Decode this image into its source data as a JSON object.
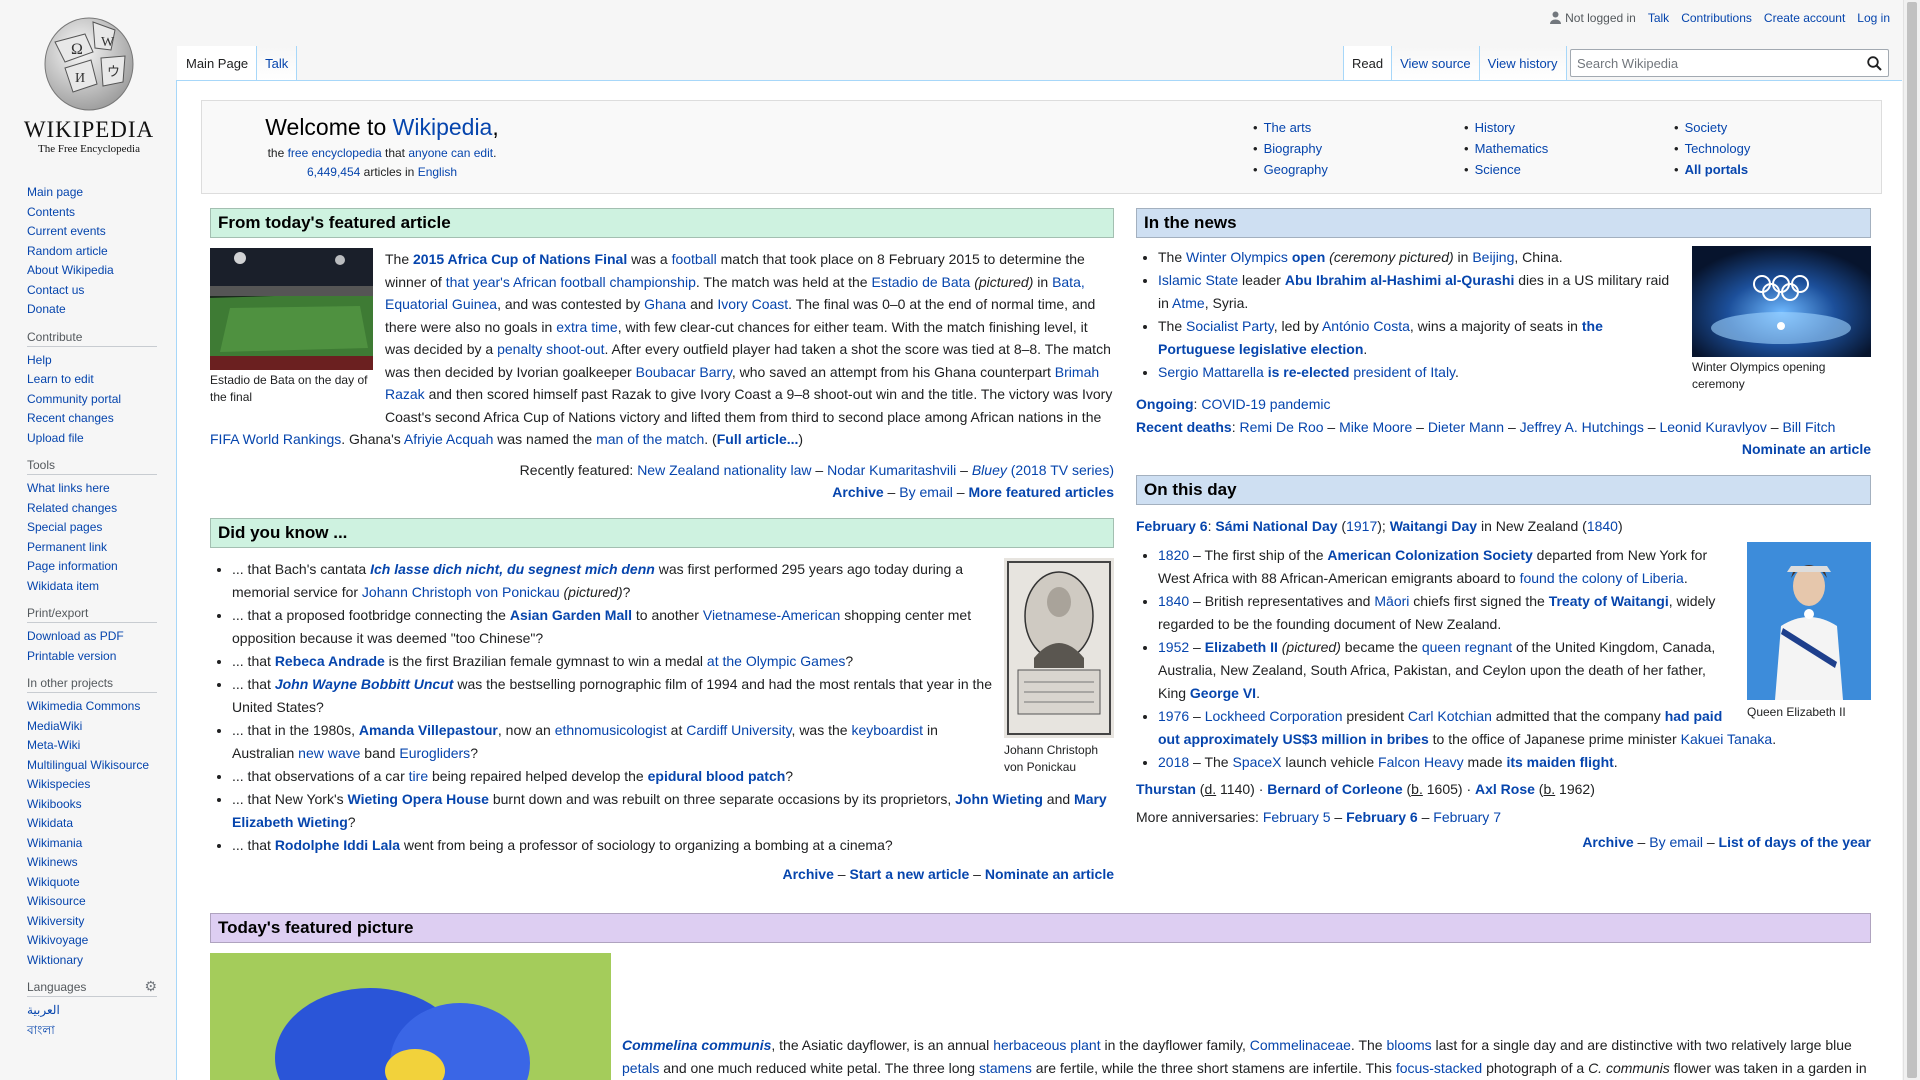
{
  "logo": {
    "wordmark": "WIKIPEDIA",
    "tagline": "The Free Encyclopedia"
  },
  "personal": {
    "not_logged_in": "Not logged in",
    "talk": "Talk",
    "contributions": "Contributions",
    "create_account": "Create account",
    "login": "Log in"
  },
  "tabs": {
    "main_page": "Main Page",
    "talk": "Talk",
    "read": "Read",
    "view_source": "View source",
    "view_history": "View history"
  },
  "search": {
    "placeholder": "Search Wikipedia"
  },
  "sidebar": {
    "nav": [
      "Main page",
      "Contents",
      "Current events",
      "Random article",
      "About Wikipedia",
      "Contact us",
      "Donate"
    ],
    "contribute_heading": "Contribute",
    "contribute": [
      "Help",
      "Learn to edit",
      "Community portal",
      "Recent changes",
      "Upload file"
    ],
    "tools_heading": "Tools",
    "tools": [
      "What links here",
      "Related changes",
      "Special pages",
      "Permanent link",
      "Page information",
      "Wikidata item"
    ],
    "print_heading": "Print/export",
    "print": [
      "Download as PDF",
      "Printable version"
    ],
    "projects_heading": "In other projects",
    "projects": [
      "Wikimedia Commons",
      "MediaWiki",
      "Meta-Wiki",
      "Multilingual Wikisource",
      "Wikispecies",
      "Wikibooks",
      "Wikidata",
      "Wikimania",
      "Wikinews",
      "Wikiquote",
      "Wikisource",
      "Wikiversity",
      "Wikivoyage",
      "Wiktionary"
    ],
    "languages_heading": "Languages",
    "languages": [
      "العربية",
      "বাংলা"
    ]
  },
  "welcome": {
    "welcome_to": "Welcome to ",
    "wikipedia": "Wikipedia",
    "comma": ",",
    "the": "the ",
    "free_encyclopedia": "free encyclopedia",
    "that": " that ",
    "anyone_can_edit": "anyone can edit",
    "period": ".",
    "article_count": "6,449,454",
    "articles_in": " articles in ",
    "english": "English"
  },
  "portals": {
    "col1": [
      "The arts",
      "Biography",
      "Geography"
    ],
    "col2": [
      "History",
      "Mathematics",
      "Science"
    ],
    "col3": [
      "Society",
      "Technology",
      "All portals"
    ]
  },
  "featured": {
    "heading": "From today's featured article",
    "caption": "Estadio de Bata on the day of the final",
    "recently_label": "Recently featured: ",
    "recent": [
      "New Zealand nationality law",
      "Nodar Kumaritashvili",
      "Bluey",
      "(2018 TV series)"
    ],
    "archive": "Archive",
    "by_email": "By email",
    "more": "More featured articles",
    "full_article": "Full article..."
  },
  "dyk": {
    "heading": "Did you know ...",
    "caption": "Johann Christoph von Ponickau",
    "archive": "Archive",
    "start": "Start a new article",
    "nominate": "Nominate an article"
  },
  "news": {
    "heading": "In the news",
    "caption": "Winter Olympics opening ceremony",
    "ongoing_label": "Ongoing",
    "ongoing": "COVID-19 pandemic",
    "deaths_label": "Recent deaths",
    "deaths": [
      "Remi De Roo",
      "Mike Moore",
      "Dieter Mann",
      "Jeffrey A. Hutchings",
      "Leonid Kuravlyov",
      "Bill Fitch"
    ],
    "nominate": "Nominate an article"
  },
  "otd": {
    "heading": "On this day",
    "caption": "Queen Elizabeth II",
    "more_label": "More anniversaries: ",
    "more": [
      "February 5",
      "February 6",
      "February 7"
    ],
    "archive": "Archive",
    "by_email": "By email",
    "list": "List of days of the year"
  },
  "tfp": {
    "heading": "Today's featured picture"
  }
}
